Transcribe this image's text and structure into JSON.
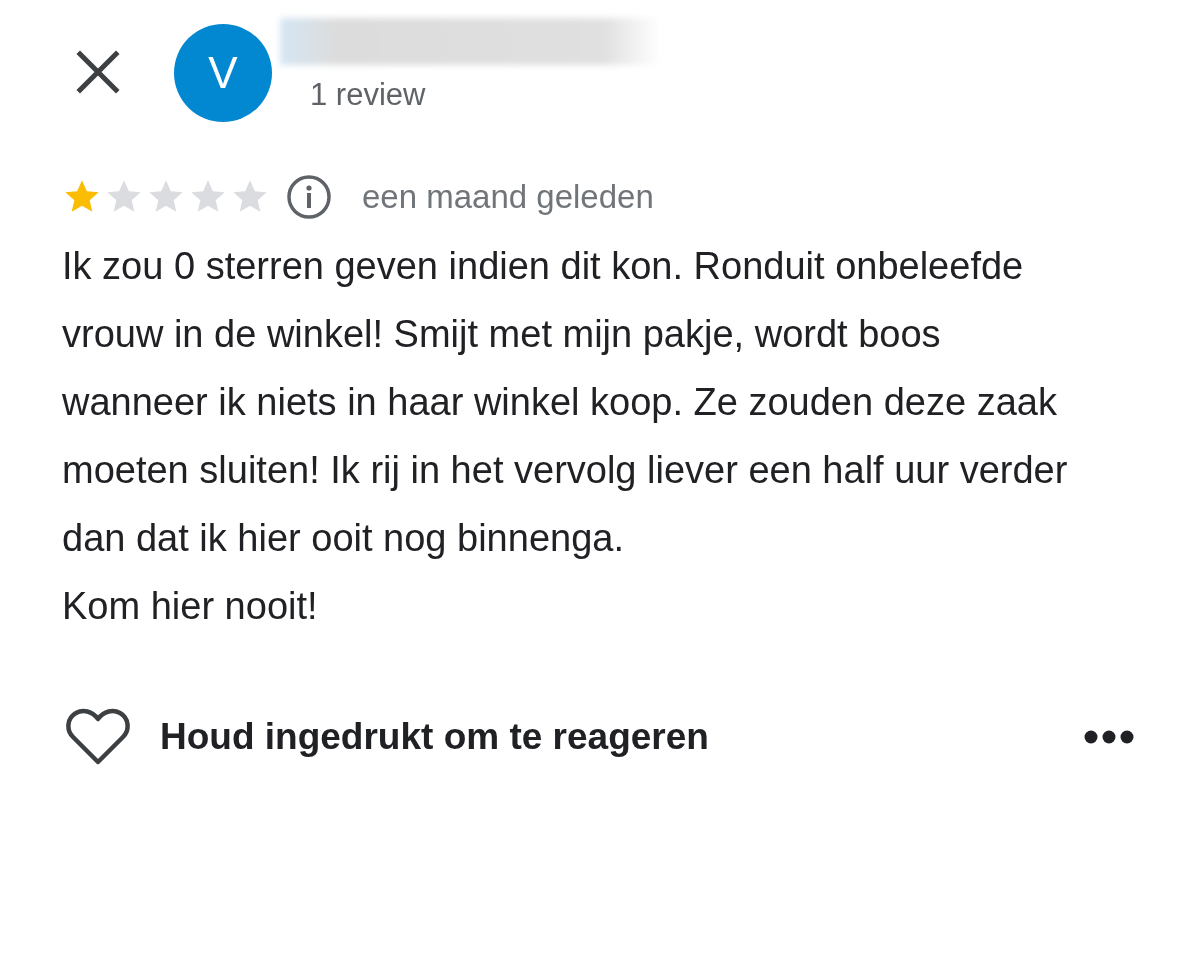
{
  "reviewer": {
    "initial": "V",
    "review_count": "1 review"
  },
  "review": {
    "stars": 1,
    "time": "een maand geleden",
    "text": "Ik zou 0 sterren geven indien dit kon. Ronduit onbeleefde vrouw in de winkel! Smijt met mijn pakje, wordt boos wanneer ik niets in haar winkel koop. Ze zouden deze zaak moeten sluiten! Ik rij in het vervolg liever een half uur verder dan dat ik hier ooit nog binnenga.\nKom hier nooit!"
  },
  "footer": {
    "react_label": "Houd ingedrukt om te reageren"
  }
}
